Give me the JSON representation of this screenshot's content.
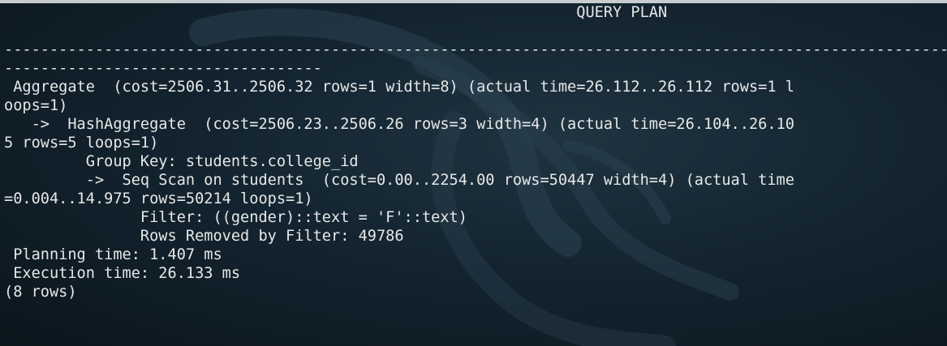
{
  "terminal": {
    "lines": [
      "                                                               QUERY PLAN",
      "",
      "----------------------------------------------------------------------------------------------------------------",
      "-----------------------------------",
      " Aggregate  (cost=2506.31..2506.32 rows=1 width=8) (actual time=26.112..26.112 rows=1 l",
      "oops=1)",
      "   ->  HashAggregate  (cost=2506.23..2506.26 rows=3 width=4) (actual time=26.104..26.10",
      "5 rows=5 loops=1)",
      "         Group Key: students.college_id",
      "         ->  Seq Scan on students  (cost=0.00..2254.00 rows=50447 width=4) (actual time",
      "=0.004..14.975 rows=50214 loops=1)",
      "               Filter: ((gender)::text = 'F'::text)",
      "               Rows Removed by Filter: 49786",
      " Planning time: 1.407 ms",
      " Execution time: 26.133 ms",
      "(8 rows)"
    ]
  },
  "colors": {
    "text": "#e6e8e8",
    "background": "#132430"
  },
  "icons": {
    "watermark": "kali-dragon-icon"
  }
}
